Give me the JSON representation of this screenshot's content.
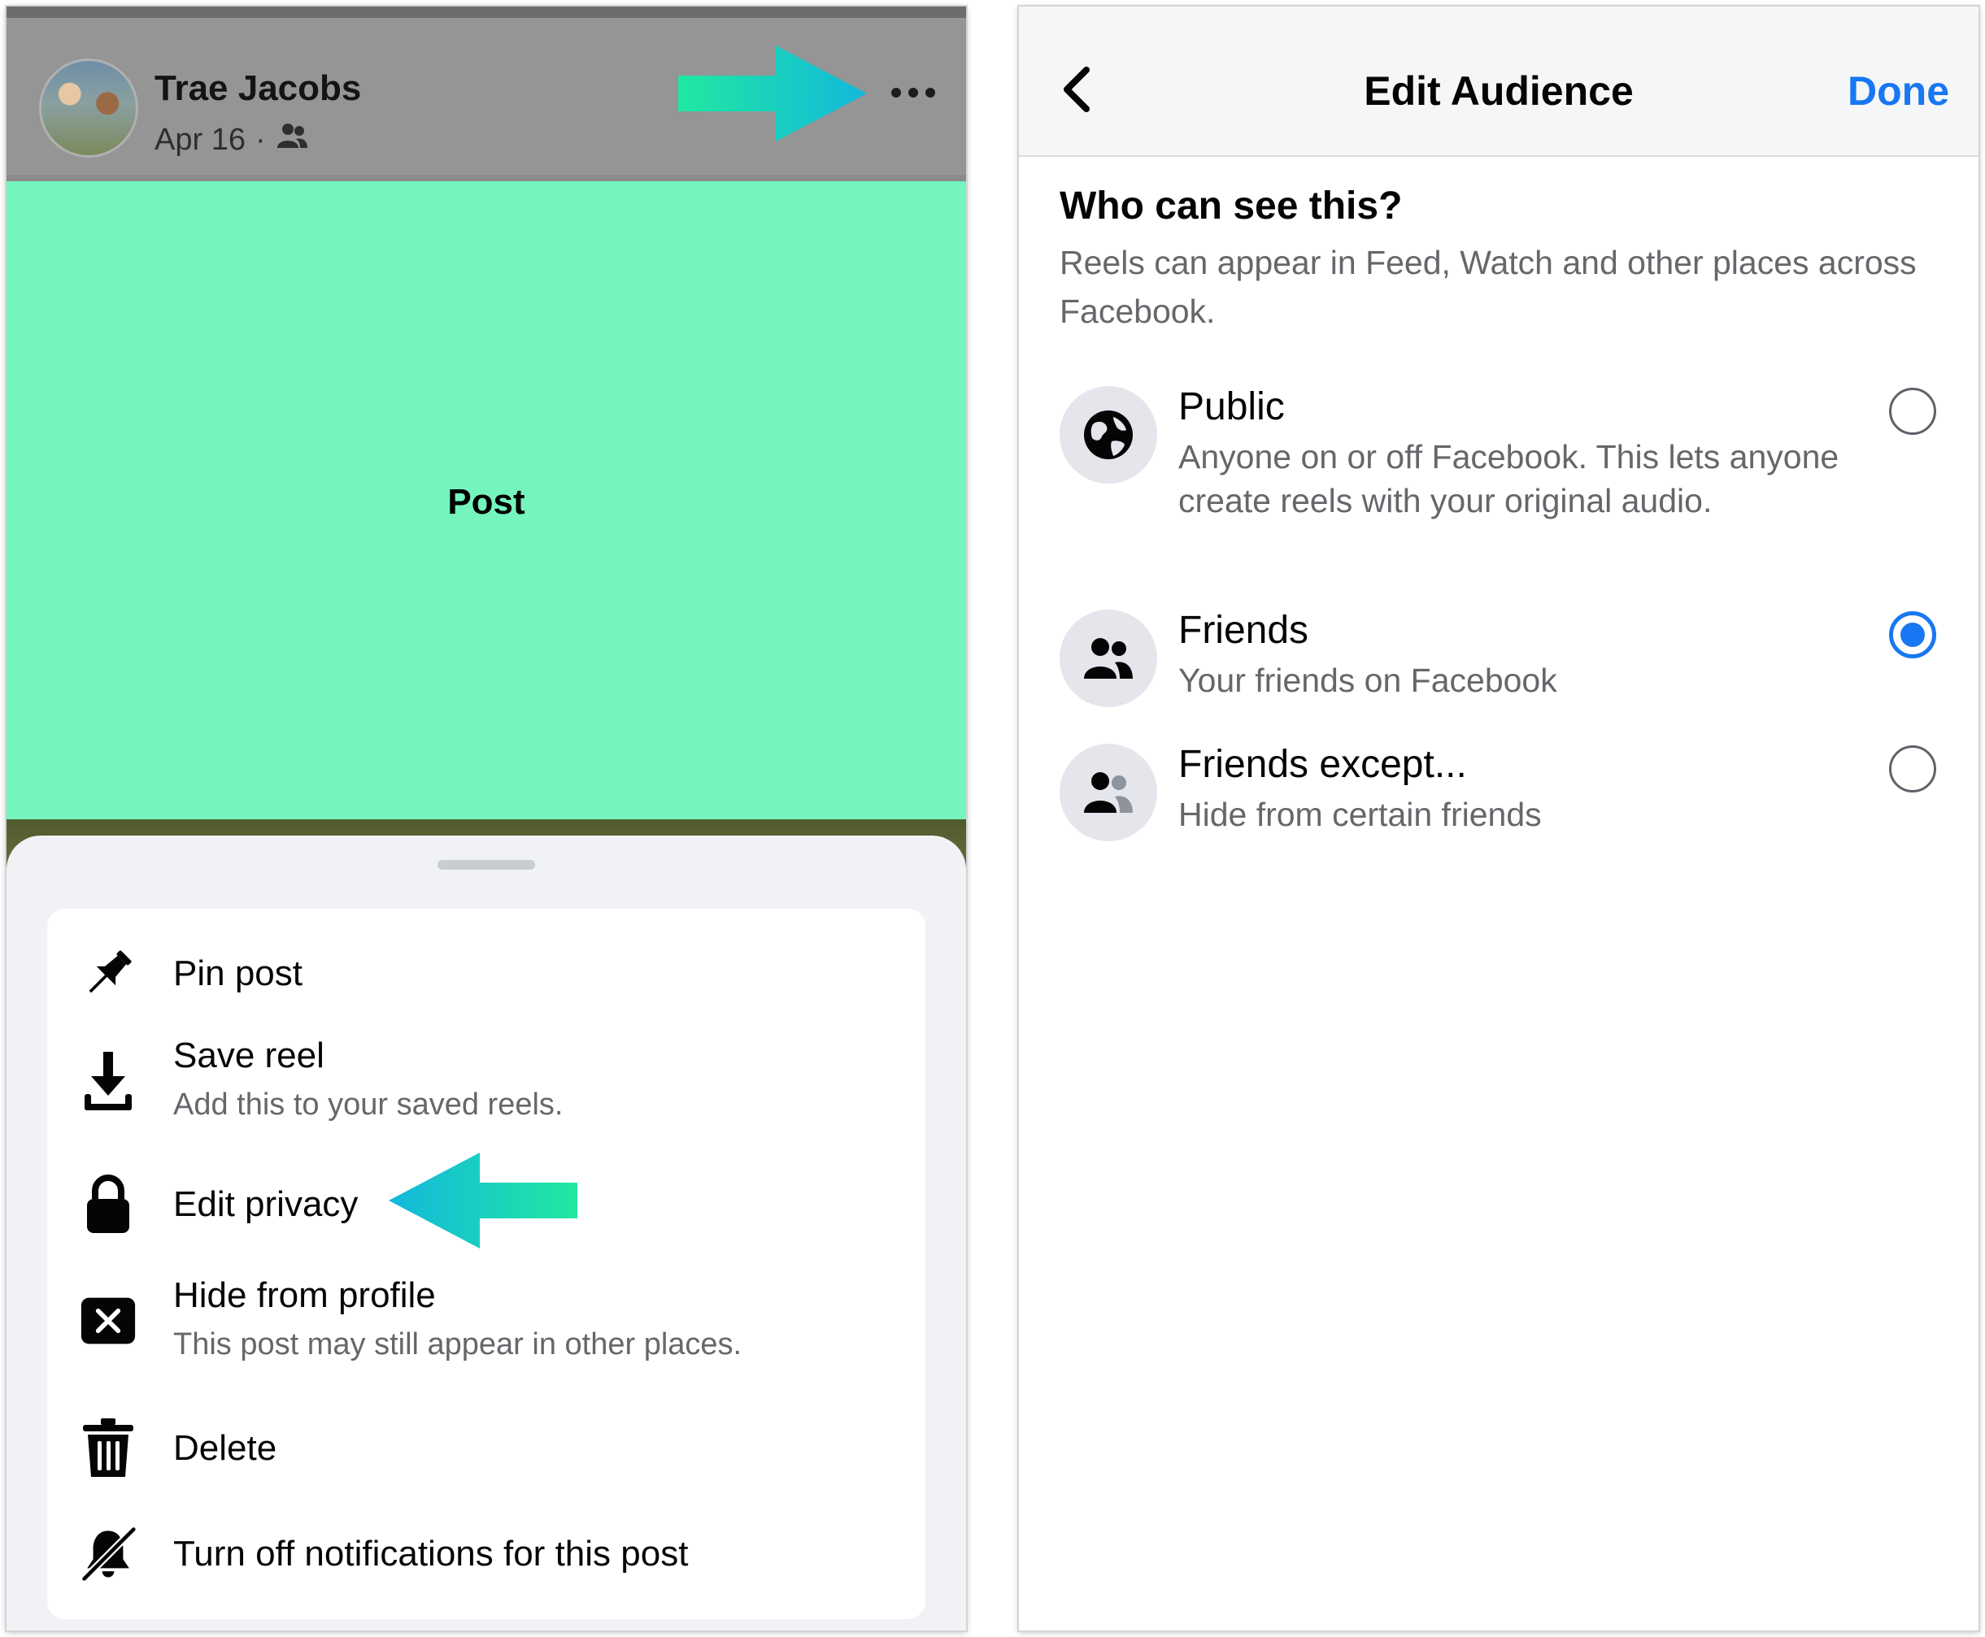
{
  "post_view": {
    "author_name": "Trae Jacobs",
    "post_date": "Apr 16",
    "meta_separator": "·",
    "audience_icon": "friends-icon",
    "more_icon": "more-horizontal-icon",
    "post_label": "Post",
    "annotation_arrow_color": "#1cc8d4"
  },
  "options_sheet": {
    "items": [
      {
        "icon": "pin-icon",
        "label": "Pin post",
        "sublabel": ""
      },
      {
        "icon": "download-icon",
        "label": "Save reel",
        "sublabel": "Add this to your saved reels."
      },
      {
        "icon": "lock-icon",
        "label": "Edit privacy",
        "sublabel": ""
      },
      {
        "icon": "hide-x-icon",
        "label": "Hide from profile",
        "sublabel": "This post may still appear in other places."
      },
      {
        "icon": "trash-icon",
        "label": "Delete",
        "sublabel": ""
      },
      {
        "icon": "bell-off-icon",
        "label": "Turn off notifications for this post",
        "sublabel": ""
      }
    ]
  },
  "edit_audience": {
    "title": "Edit Audience",
    "done_label": "Done",
    "back_icon": "chevron-left-icon",
    "accent_color": "#1877f2",
    "question": "Who can see this?",
    "question_desc": "Reels can appear in Feed, Watch and other places across Facebook.",
    "options": [
      {
        "icon": "globe-icon",
        "title": "Public",
        "desc": "Anyone on or off Facebook. This lets anyone create reels with your original audio.",
        "selected": false
      },
      {
        "icon": "friends-icon",
        "title": "Friends",
        "desc": "Your friends on Facebook",
        "selected": true
      },
      {
        "icon": "friends-except-icon",
        "title": "Friends except...",
        "desc": "Hide from certain friends",
        "selected": false
      }
    ]
  }
}
